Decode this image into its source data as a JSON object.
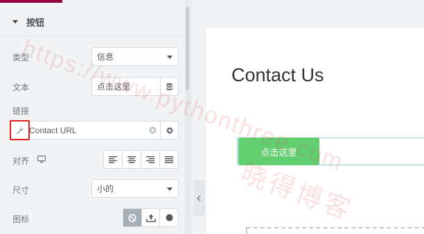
{
  "panel": {
    "section_title": "按钮",
    "type": {
      "label": "类型",
      "value": "信息"
    },
    "text": {
      "label": "文本",
      "value": "点击这里"
    },
    "link": {
      "label": "链接",
      "placeholder": "Contact URL"
    },
    "align": {
      "label": "对齐",
      "options": [
        "left",
        "center",
        "right",
        "justify"
      ]
    },
    "size": {
      "label": "尺寸",
      "value": "小的"
    },
    "icon": {
      "label": "图标",
      "options": [
        "none",
        "upload",
        "circle"
      ],
      "active": "none"
    }
  },
  "preview": {
    "heading": "Contact Us",
    "button_label": "点击这里"
  },
  "watermark": {
    "url": "https://www.pythonthree.com",
    "name": "晓得博客"
  },
  "colors": {
    "accent": "#93003c",
    "button": "#61ce70",
    "highlight": "#e21b1b",
    "column_outline": "#8fd4e6"
  }
}
